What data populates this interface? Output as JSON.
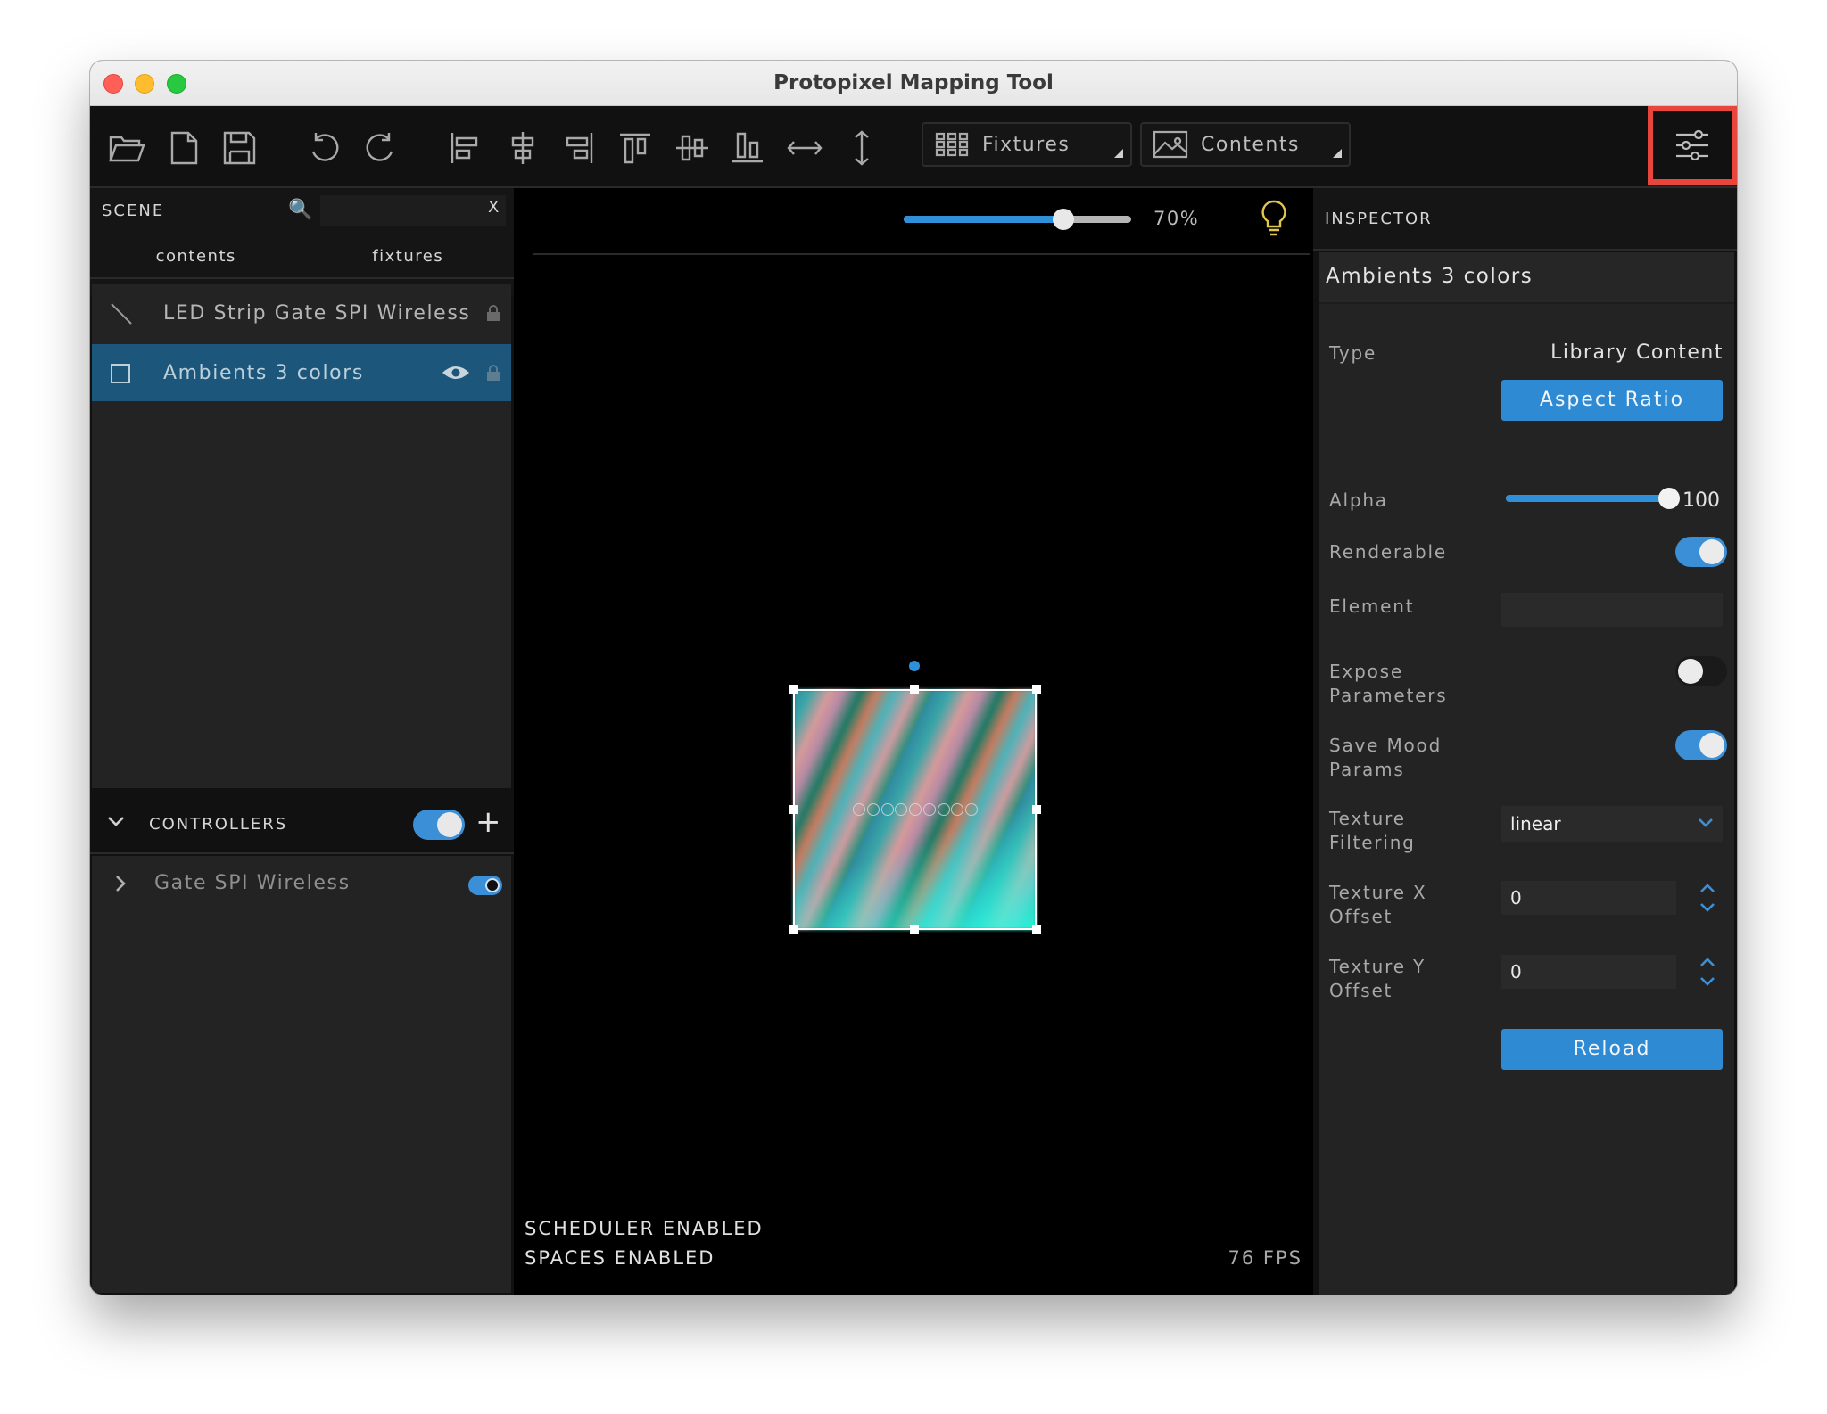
{
  "window": {
    "title": "Protopixel Mapping Tool"
  },
  "toolbar": {
    "icons": [
      "open-folder-icon",
      "new-file-icon",
      "save-icon",
      "undo-icon",
      "redo-icon",
      "align-left-icon",
      "align-center-horizontal-icon",
      "align-right-icon",
      "align-top-icon",
      "align-middle-vertical-icon",
      "align-bottom-icon",
      "distribute-horizontal-icon",
      "distribute-vertical-icon"
    ],
    "fixtures_label": "Fixtures",
    "contents_label": "Contents",
    "highlight_color": "#e8453c"
  },
  "scene": {
    "label": "SCENE",
    "search_value": "",
    "clear_label": "X",
    "tabs": [
      "contents",
      "fixtures"
    ],
    "items": [
      {
        "label": "LED Strip Gate SPI Wireless",
        "icon": "line-icon",
        "selected": false
      },
      {
        "label": "Ambients 3 colors",
        "icon": "square-icon",
        "selected": true
      }
    ]
  },
  "controllers": {
    "label": "CONTROLLERS",
    "enabled": true,
    "add_label": "+",
    "items": [
      {
        "label": "Gate SPI Wireless",
        "enabled": true
      }
    ]
  },
  "canvas": {
    "zoom_percent": 70,
    "zoom_label": "70%",
    "status_lines": [
      "SCHEDULER ENABLED",
      "SPACES ENABLED"
    ],
    "fps": "76 FPS"
  },
  "inspector": {
    "label": "INSPECTOR",
    "title": "Ambients 3 colors",
    "type_label": "Type",
    "type_value": "Library Content",
    "aspect_button": "Aspect Ratio",
    "alpha_label": "Alpha",
    "alpha_value": "100",
    "alpha_level": 1.0,
    "renderable_label": "Renderable",
    "renderable": true,
    "element_label": "Element",
    "element_value": "",
    "expose_label": "Expose Parameters",
    "expose": false,
    "save_mood_label": "Save Mood Params",
    "save_mood": true,
    "filtering_label": "Texture Filtering",
    "filtering_value": "linear",
    "tex_x_label": "Texture X Offset",
    "tex_x_value": "0",
    "tex_y_label": "Texture Y Offset",
    "tex_y_value": "0",
    "reload_button": "Reload"
  },
  "colors": {
    "accent": "#2f8ad4",
    "selection": "#1c567a"
  }
}
